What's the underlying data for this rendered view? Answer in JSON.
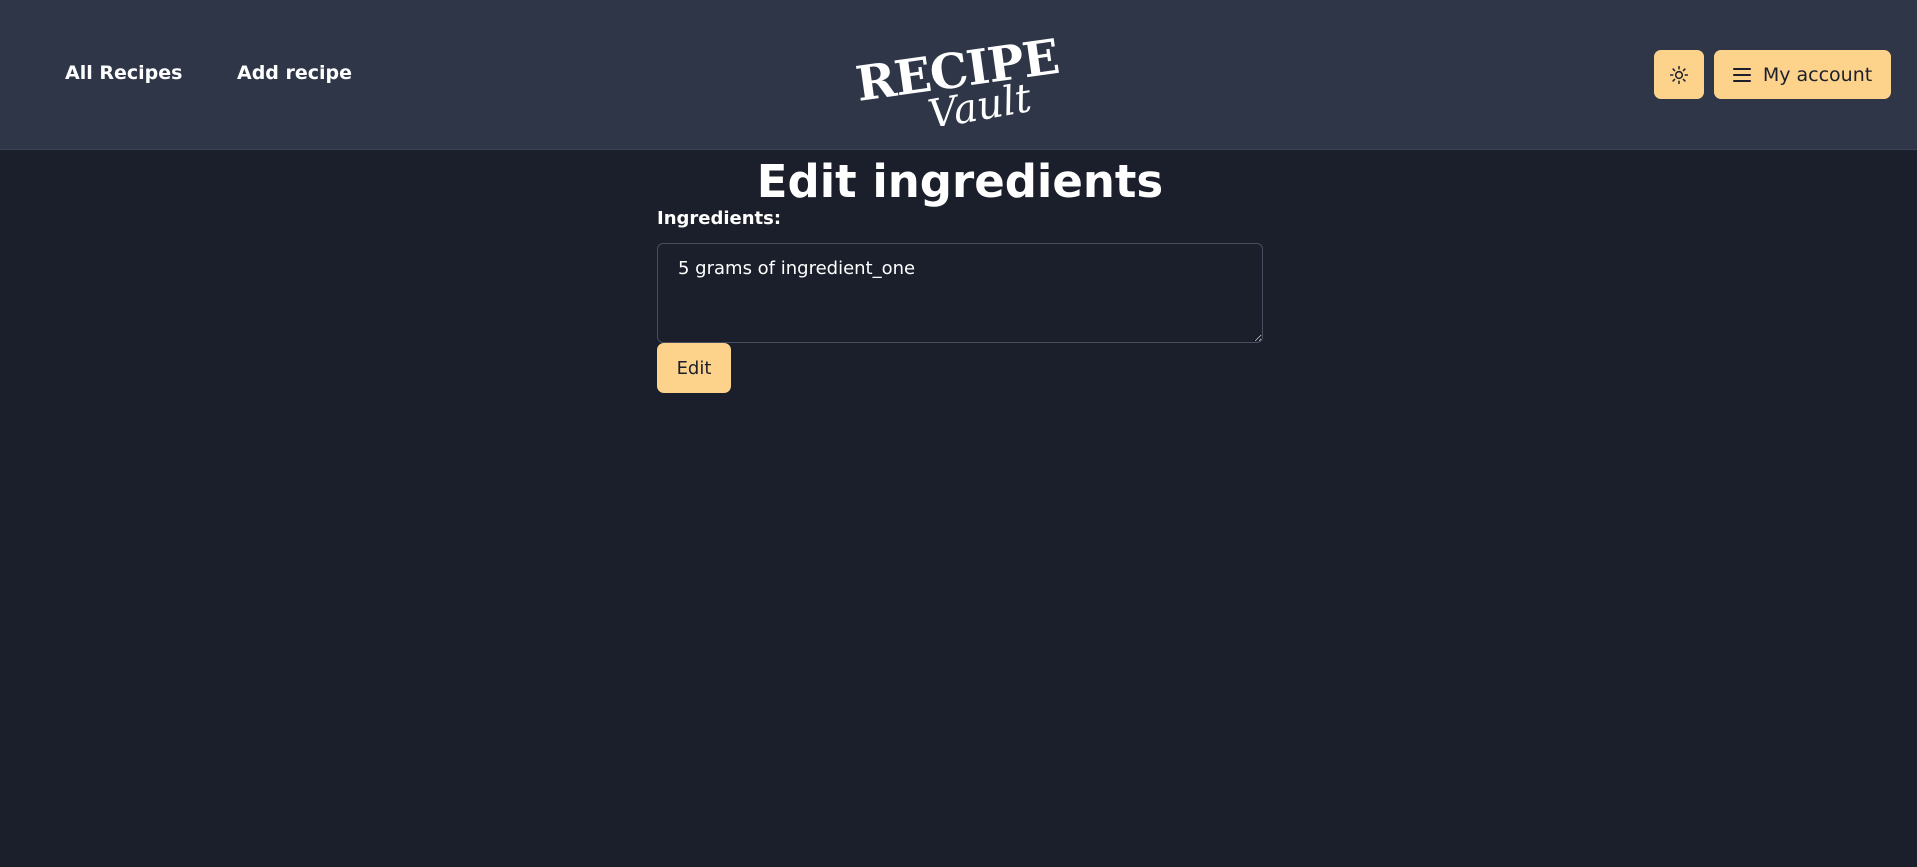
{
  "nav": {
    "all_recipes": "All Recipes",
    "add_recipe": "Add recipe"
  },
  "logo": {
    "line1": "RECIPE",
    "line2": "Vault"
  },
  "header": {
    "theme_icon": "sun-icon",
    "menu_icon": "hamburger-icon",
    "account_label": "My account"
  },
  "main": {
    "title": "Edit ingredients",
    "ingredients_label": "Ingredients:",
    "ingredients_value": "5 grams of ingredient_one",
    "edit_label": "Edit"
  },
  "colors": {
    "background": "#1b1f2b",
    "navbar": "#2e3648",
    "accent": "#fdd38c",
    "text": "#ffffff"
  }
}
